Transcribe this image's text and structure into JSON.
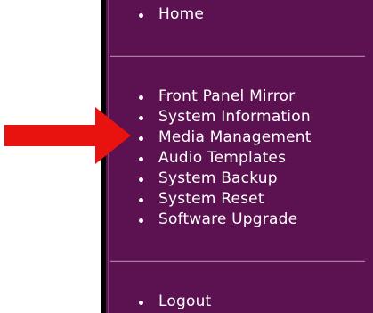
{
  "nav": {
    "top_items": [
      {
        "label": "Home"
      }
    ],
    "main_items": [
      {
        "label": "Front Panel Mirror"
      },
      {
        "label": "System Information"
      },
      {
        "label": "Media Management"
      },
      {
        "label": "Audio Templates"
      },
      {
        "label": "System Backup"
      },
      {
        "label": "System Reset"
      },
      {
        "label": "Software Upgrade"
      }
    ],
    "bottom_items": [
      {
        "label": "Logout"
      }
    ]
  },
  "highlight": {
    "target": "Media Management",
    "icon": "right-arrow-icon",
    "color": "#e8120f"
  },
  "colors": {
    "panel_background": "#5c1150",
    "text": "#ffffff",
    "border": "#000000"
  }
}
